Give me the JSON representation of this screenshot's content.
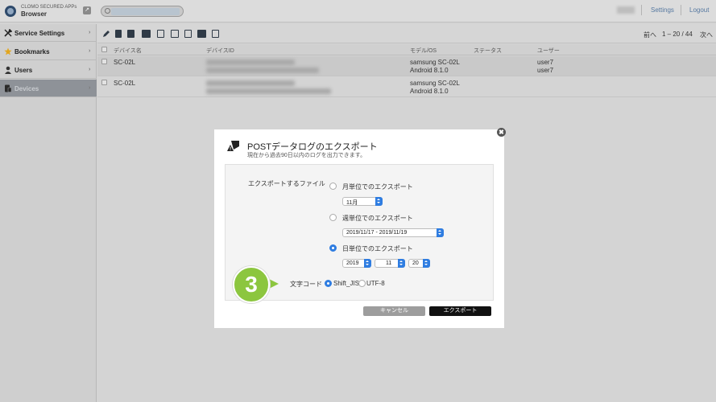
{
  "header": {
    "brand_line1": "CLOMO SECURED APPs",
    "brand_line2": "Browser",
    "search_placeholder": "",
    "settings_link": "Settings",
    "logout_link": "Logout"
  },
  "sidebar": {
    "items": [
      {
        "label": "Service Settings",
        "icon": "wrench-icon"
      },
      {
        "label": "Bookmarks",
        "icon": "star-icon"
      },
      {
        "label": "Users",
        "icon": "user-icon"
      },
      {
        "label": "Devices",
        "icon": "device-icon"
      }
    ]
  },
  "toolbar": {
    "prev_label": "前へ",
    "range_label": "1 – 20 / 44",
    "next_label": "次へ"
  },
  "table": {
    "columns": [
      "デバイス名",
      "デバイスID",
      "モデル/OS",
      "ステータス",
      "ユーザー"
    ],
    "rows": [
      {
        "name": "SC-02L",
        "model": "samsung SC-02L",
        "os": "Android 8.1.0",
        "user1": "user7",
        "user2": "user7"
      },
      {
        "name": "SC-02L",
        "model": "samsung SC-02L",
        "os": "Android 8.1.0",
        "user1": "",
        "user2": ""
      }
    ]
  },
  "modal": {
    "title": "POSTデータログのエクスポート",
    "subtitle": "現在から過去90日以内のログを出力できます。",
    "file_label": "エクスポートするファイル",
    "monthly_label": "月単位でのエクスポート",
    "monthly_value": "11月",
    "weekly_label": "週単位でのエクスポート",
    "weekly_value": "2019/11/17 - 2019/11/19",
    "daily_label": "日単位でのエクスポート",
    "daily_year": "2019",
    "daily_month": "11",
    "daily_day": "20",
    "charset_label": "文字コード",
    "charset_shift_jis": "Shift_JIS",
    "charset_utf8": "UTF-8",
    "cancel_button": "キャンセル",
    "export_button": "エクスポート",
    "close_glyph": "✖"
  },
  "callout": {
    "number": "3",
    "color": "#8cc63f"
  },
  "colors": {
    "accent": "#2f7de1",
    "link": "#5678a0"
  }
}
